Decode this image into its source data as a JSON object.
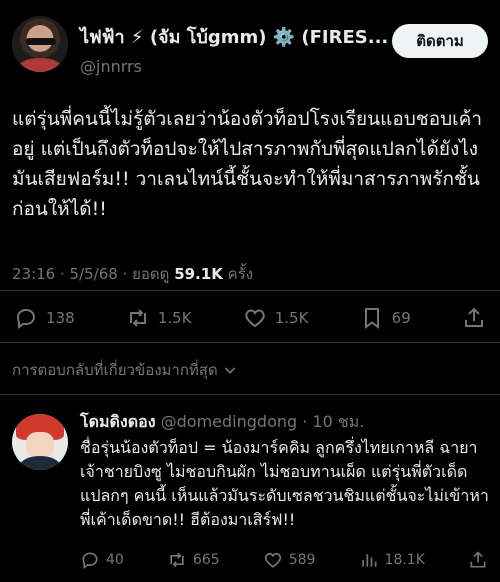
{
  "author": {
    "display_name": "ไฟฟ้า ⚡ (จัม โบ้gmm) ⚙️ (FIRES...",
    "handle": "@jnnrrs",
    "verified": true
  },
  "follow_label": "ติดตาม",
  "tweet": {
    "text": "แต่รุ่นพี่คนนี้ไม่รู้ตัวเลยว่าน้องตัวท็อปโรงเรียนแอบชอบเค้าอยู่ แต่เป็นถึงตัวท็อปจะให้ไปสารภาพกับพี่สุดแปลกได้ยังไงมันเสียฟอร์ม!! วาเลนไทน์นี้ชั้นจะทำให้พี่มาสารภาพรักชั้นก่อนให้ได้!!",
    "time": "23:16 · 5/5/68 · ยอดดู",
    "views": "59.1K",
    "views_suffix": "ครั้ง"
  },
  "actions": {
    "replies": "138",
    "reposts": "1.5K",
    "likes": "1.5K",
    "bookmarks": "69"
  },
  "relevant_replies_label": "การตอบกลับที่เกี่ยวข้องมากที่สุด",
  "reply": {
    "name": "โดมดิงดอง",
    "handle": "@domedingdong · 10 ชม.",
    "text": "ชื่อรุ่นน้องตัวท็อป = น้องมาร์คคิม ลูกครึ่งไทยเกาหลี ฉายาเจ้าชายบิงซู ไม่ชอบกินผัก ไม่ชอบทานเผ็ด แต่รุ่นพี่ตัวเด็ดแปลกๆ คนนี้ เห็นแล้วมันระดับเซลชวนชิมแต่ชั้นจะไม่เข้าหาพี่เค้าเด็ดขาด!! ฮีต้องมาเสิร์ฟ!!",
    "replies": "40",
    "reposts": "665",
    "likes": "589",
    "views": "18.1K"
  },
  "icons": [
    "verified-badge-icon",
    "reply-icon",
    "repost-icon",
    "like-icon",
    "bookmark-icon",
    "share-icon",
    "chevron-down-icon",
    "views-icon"
  ],
  "colors": {
    "background": "#000000",
    "text": "#e7e9ea",
    "muted": "#71767b",
    "verified": "#1d9bf0",
    "follow_bg": "#eff3f4"
  }
}
